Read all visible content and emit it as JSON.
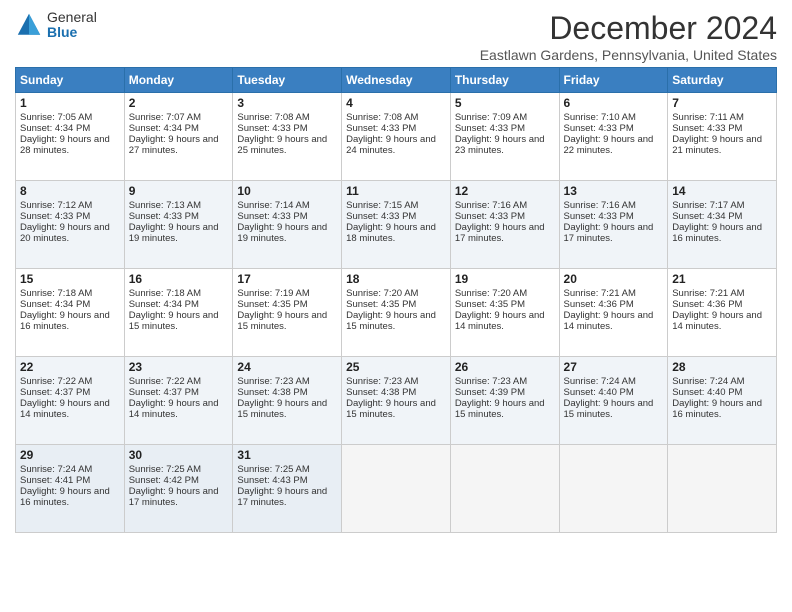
{
  "header": {
    "logo_general": "General",
    "logo_blue": "Blue",
    "title": "December 2024",
    "location": "Eastlawn Gardens, Pennsylvania, United States"
  },
  "days_of_week": [
    "Sunday",
    "Monday",
    "Tuesday",
    "Wednesday",
    "Thursday",
    "Friday",
    "Saturday"
  ],
  "weeks": [
    [
      {
        "day": "1",
        "sunrise": "Sunrise: 7:05 AM",
        "sunset": "Sunset: 4:34 PM",
        "daylight": "Daylight: 9 hours and 28 minutes."
      },
      {
        "day": "2",
        "sunrise": "Sunrise: 7:07 AM",
        "sunset": "Sunset: 4:34 PM",
        "daylight": "Daylight: 9 hours and 27 minutes."
      },
      {
        "day": "3",
        "sunrise": "Sunrise: 7:08 AM",
        "sunset": "Sunset: 4:33 PM",
        "daylight": "Daylight: 9 hours and 25 minutes."
      },
      {
        "day": "4",
        "sunrise": "Sunrise: 7:08 AM",
        "sunset": "Sunset: 4:33 PM",
        "daylight": "Daylight: 9 hours and 24 minutes."
      },
      {
        "day": "5",
        "sunrise": "Sunrise: 7:09 AM",
        "sunset": "Sunset: 4:33 PM",
        "daylight": "Daylight: 9 hours and 23 minutes."
      },
      {
        "day": "6",
        "sunrise": "Sunrise: 7:10 AM",
        "sunset": "Sunset: 4:33 PM",
        "daylight": "Daylight: 9 hours and 22 minutes."
      },
      {
        "day": "7",
        "sunrise": "Sunrise: 7:11 AM",
        "sunset": "Sunset: 4:33 PM",
        "daylight": "Daylight: 9 hours and 21 minutes."
      }
    ],
    [
      {
        "day": "8",
        "sunrise": "Sunrise: 7:12 AM",
        "sunset": "Sunset: 4:33 PM",
        "daylight": "Daylight: 9 hours and 20 minutes."
      },
      {
        "day": "9",
        "sunrise": "Sunrise: 7:13 AM",
        "sunset": "Sunset: 4:33 PM",
        "daylight": "Daylight: 9 hours and 19 minutes."
      },
      {
        "day": "10",
        "sunrise": "Sunrise: 7:14 AM",
        "sunset": "Sunset: 4:33 PM",
        "daylight": "Daylight: 9 hours and 19 minutes."
      },
      {
        "day": "11",
        "sunrise": "Sunrise: 7:15 AM",
        "sunset": "Sunset: 4:33 PM",
        "daylight": "Daylight: 9 hours and 18 minutes."
      },
      {
        "day": "12",
        "sunrise": "Sunrise: 7:16 AM",
        "sunset": "Sunset: 4:33 PM",
        "daylight": "Daylight: 9 hours and 17 minutes."
      },
      {
        "day": "13",
        "sunrise": "Sunrise: 7:16 AM",
        "sunset": "Sunset: 4:33 PM",
        "daylight": "Daylight: 9 hours and 17 minutes."
      },
      {
        "day": "14",
        "sunrise": "Sunrise: 7:17 AM",
        "sunset": "Sunset: 4:34 PM",
        "daylight": "Daylight: 9 hours and 16 minutes."
      }
    ],
    [
      {
        "day": "15",
        "sunrise": "Sunrise: 7:18 AM",
        "sunset": "Sunset: 4:34 PM",
        "daylight": "Daylight: 9 hours and 16 minutes."
      },
      {
        "day": "16",
        "sunrise": "Sunrise: 7:18 AM",
        "sunset": "Sunset: 4:34 PM",
        "daylight": "Daylight: 9 hours and 15 minutes."
      },
      {
        "day": "17",
        "sunrise": "Sunrise: 7:19 AM",
        "sunset": "Sunset: 4:35 PM",
        "daylight": "Daylight: 9 hours and 15 minutes."
      },
      {
        "day": "18",
        "sunrise": "Sunrise: 7:20 AM",
        "sunset": "Sunset: 4:35 PM",
        "daylight": "Daylight: 9 hours and 15 minutes."
      },
      {
        "day": "19",
        "sunrise": "Sunrise: 7:20 AM",
        "sunset": "Sunset: 4:35 PM",
        "daylight": "Daylight: 9 hours and 14 minutes."
      },
      {
        "day": "20",
        "sunrise": "Sunrise: 7:21 AM",
        "sunset": "Sunset: 4:36 PM",
        "daylight": "Daylight: 9 hours and 14 minutes."
      },
      {
        "day": "21",
        "sunrise": "Sunrise: 7:21 AM",
        "sunset": "Sunset: 4:36 PM",
        "daylight": "Daylight: 9 hours and 14 minutes."
      }
    ],
    [
      {
        "day": "22",
        "sunrise": "Sunrise: 7:22 AM",
        "sunset": "Sunset: 4:37 PM",
        "daylight": "Daylight: 9 hours and 14 minutes."
      },
      {
        "day": "23",
        "sunrise": "Sunrise: 7:22 AM",
        "sunset": "Sunset: 4:37 PM",
        "daylight": "Daylight: 9 hours and 14 minutes."
      },
      {
        "day": "24",
        "sunrise": "Sunrise: 7:23 AM",
        "sunset": "Sunset: 4:38 PM",
        "daylight": "Daylight: 9 hours and 15 minutes."
      },
      {
        "day": "25",
        "sunrise": "Sunrise: 7:23 AM",
        "sunset": "Sunset: 4:38 PM",
        "daylight": "Daylight: 9 hours and 15 minutes."
      },
      {
        "day": "26",
        "sunrise": "Sunrise: 7:23 AM",
        "sunset": "Sunset: 4:39 PM",
        "daylight": "Daylight: 9 hours and 15 minutes."
      },
      {
        "day": "27",
        "sunrise": "Sunrise: 7:24 AM",
        "sunset": "Sunset: 4:40 PM",
        "daylight": "Daylight: 9 hours and 15 minutes."
      },
      {
        "day": "28",
        "sunrise": "Sunrise: 7:24 AM",
        "sunset": "Sunset: 4:40 PM",
        "daylight": "Daylight: 9 hours and 16 minutes."
      }
    ],
    [
      {
        "day": "29",
        "sunrise": "Sunrise: 7:24 AM",
        "sunset": "Sunset: 4:41 PM",
        "daylight": "Daylight: 9 hours and 16 minutes."
      },
      {
        "day": "30",
        "sunrise": "Sunrise: 7:25 AM",
        "sunset": "Sunset: 4:42 PM",
        "daylight": "Daylight: 9 hours and 17 minutes."
      },
      {
        "day": "31",
        "sunrise": "Sunrise: 7:25 AM",
        "sunset": "Sunset: 4:43 PM",
        "daylight": "Daylight: 9 hours and 17 minutes."
      },
      null,
      null,
      null,
      null
    ]
  ]
}
